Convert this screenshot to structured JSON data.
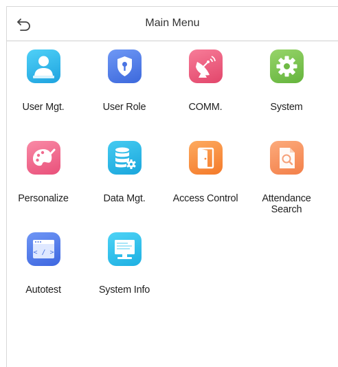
{
  "header": {
    "title": "Main Menu",
    "back_icon": "back-arrow-icon"
  },
  "menu": [
    {
      "id": "user-mgt",
      "label": "User Mgt.",
      "icon": "user-icon",
      "color": "#29b6e9"
    },
    {
      "id": "user-role",
      "label": "User Role",
      "icon": "shield-key-icon",
      "color": "#4f7fe8"
    },
    {
      "id": "comm",
      "label": "COMM.",
      "icon": "satellite-dish-icon",
      "color": "#ef5b7b"
    },
    {
      "id": "system",
      "label": "System",
      "icon": "gear-icon",
      "color": "#7cc24f"
    },
    {
      "id": "personalize",
      "label": "Personalize",
      "icon": "palette-icon",
      "color": "#f0648a"
    },
    {
      "id": "data-mgt",
      "label": "Data Mgt.",
      "icon": "database-gear-icon",
      "color": "#22b5e3"
    },
    {
      "id": "access-control",
      "label": "Access Control",
      "icon": "door-icon",
      "color": "#f98a3a"
    },
    {
      "id": "attendance-search",
      "label": "Attendance",
      "label2": "Search",
      "icon": "document-search-icon",
      "color": "#f7935a"
    },
    {
      "id": "autotest",
      "label": "Autotest",
      "icon": "code-window-icon",
      "color": "#4f78ec"
    },
    {
      "id": "system-info",
      "label": "System Info",
      "icon": "monitor-icon",
      "color": "#2bbde8"
    }
  ]
}
